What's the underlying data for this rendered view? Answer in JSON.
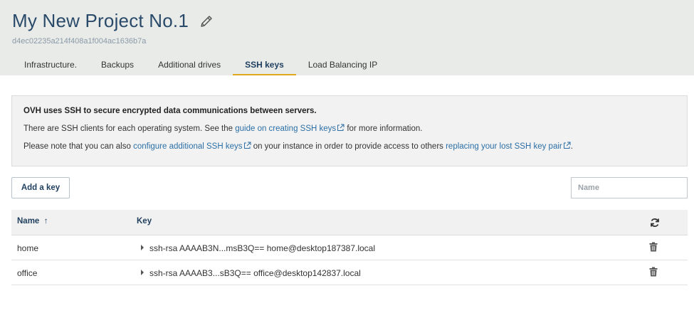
{
  "project": {
    "title": "My New Project No.1",
    "id": "d4ec02235a214f408a1f004ac1636b7a"
  },
  "tabs": [
    {
      "label": "Infrastructure."
    },
    {
      "label": "Backups"
    },
    {
      "label": "Additional drives"
    },
    {
      "label": "SSH keys",
      "active": true
    },
    {
      "label": "Load Balancing IP"
    }
  ],
  "info": {
    "heading": "OVH uses SSH to secure encrypted data communications between servers.",
    "line2_prefix": "There are SSH clients for each operating system. See the ",
    "line2_link": "guide on creating SSH keys",
    "line2_suffix": " for more information.",
    "line3_prefix": "Please note that you can also ",
    "line3_link1": "configure additional SSH keys",
    "line3_middle": " on your instance in order to provide access to others ",
    "line3_link2": "replacing your lost SSH key pair",
    "line3_suffix": "."
  },
  "toolbar": {
    "add_label": "Add a key",
    "filter_placeholder": "Name"
  },
  "table": {
    "columns": {
      "name": "Name",
      "sort_arrow": "↑",
      "key": "Key"
    },
    "rows": [
      {
        "name": "home",
        "key": "ssh-rsa AAAAB3N...msB3Q== home@desktop187387.local"
      },
      {
        "name": "office",
        "key": "ssh-rsa AAAAB3...sB3Q== office@desktop142837.local"
      }
    ]
  },
  "icons": {
    "edit": "pencil-icon",
    "external": "external-link-icon",
    "refresh": "refresh-icon",
    "delete": "trash-icon"
  },
  "colors": {
    "header_bg": "#e9ebe9",
    "title": "#2a4a6a",
    "link": "#2b6fa6",
    "tab_underline": "#e0a81e"
  }
}
